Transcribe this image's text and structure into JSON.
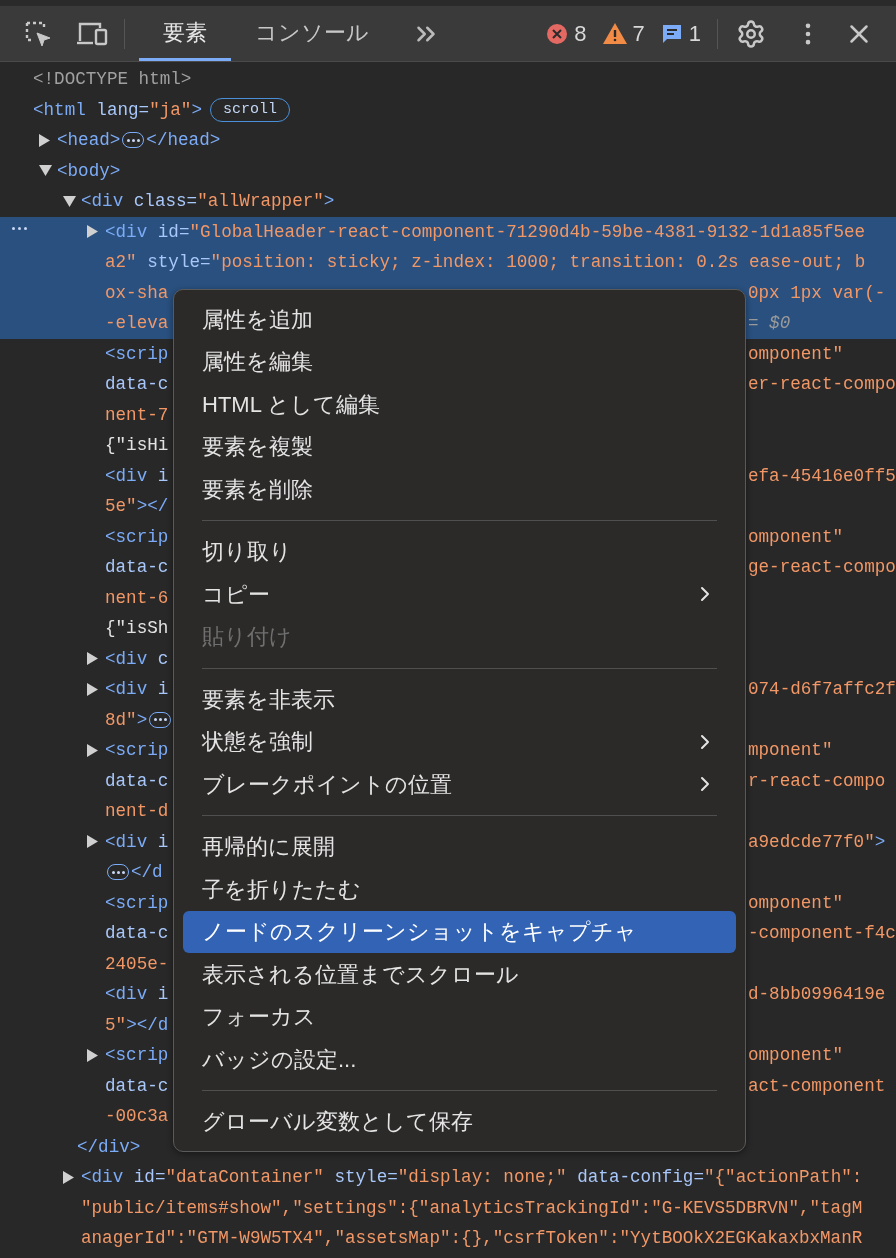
{
  "toolbar": {
    "tabs": [
      {
        "label": "要素",
        "selected": true
      },
      {
        "label": "コンソール",
        "selected": false
      }
    ],
    "counts": [
      {
        "kind": "error",
        "text": "8"
      },
      {
        "kind": "warning",
        "text": "7"
      },
      {
        "kind": "info",
        "text": "1"
      }
    ]
  },
  "tree": [
    {
      "kind": "leaf",
      "selected": false,
      "lines": [
        {
          "left": [
            {
              "kind": "doctype",
              "text": "<!DOCTYPE html>"
            }
          ]
        }
      ]
    },
    {
      "kind": "leaf",
      "selected": false,
      "lines": [
        {
          "left": [
            {
              "kind": "tag",
              "text": "<html"
            },
            {
              "kind": "attr",
              "text": " lang="
            },
            {
              "kind": "value",
              "text": "\"ja\""
            },
            {
              "kind": "tag",
              "text": ">"
            },
            {
              "kind": "badge",
              "text": "scroll"
            }
          ]
        }
      ],
      "children": [
        {
          "kind": "collapsed",
          "selected": false,
          "lines": [
            {
              "left": [
                {
                  "kind": "tag",
                  "text": "<head>"
                },
                {
                  "kind": "ellipsis"
                },
                {
                  "kind": "tag",
                  "text": "</head>"
                }
              ]
            }
          ]
        },
        {
          "kind": "expanded",
          "selected": false,
          "lines": [
            {
              "left": [
                {
                  "kind": "tag",
                  "text": "<body>"
                }
              ]
            }
          ],
          "children": [
            {
              "kind": "expanded",
              "selected": false,
              "lines": [
                {
                  "left": [
                    {
                      "kind": "tag",
                      "text": "<div"
                    },
                    {
                      "kind": "attr",
                      "text": " class="
                    },
                    {
                      "kind": "value",
                      "text": "\"allWrapper\""
                    },
                    {
                      "kind": "tag",
                      "text": ">"
                    }
                  ]
                }
              ],
              "closing": [
                {
                  "kind": "tag",
                  "text": "</div>"
                }
              ],
              "children": [
                {
                  "kind": "collapsed",
                  "selected": true,
                  "lines": [
                    {
                      "left": [
                        {
                          "kind": "tag",
                          "text": "<div"
                        },
                        {
                          "kind": "attr",
                          "text": " id="
                        },
                        {
                          "kind": "value",
                          "text": "\"GlobalHeader-react-component-71290d4b-59be-4381-9132-1d1a85f5ee"
                        }
                      ]
                    },
                    {
                      "left": [
                        {
                          "kind": "value",
                          "text": "a2\""
                        },
                        {
                          "kind": "attr",
                          "text": " style="
                        },
                        {
                          "kind": "value",
                          "text": "\"position: sticky; z-index: 1000; transition: 0.2s ease-out; b"
                        }
                      ]
                    },
                    {
                      "left": [
                        {
                          "kind": "value",
                          "text": "ox-sha"
                        }
                      ],
                      "right": [
                        {
                          "kind": "value",
                          "text": "0px 1px var(-"
                        }
                      ]
                    },
                    {
                      "left": [
                        {
                          "kind": "value",
                          "text": "-eleva"
                        }
                      ],
                      "right": [
                        {
                          "kind": "selref",
                          "text": "= $0"
                        }
                      ]
                    }
                  ]
                },
                {
                  "kind": "leaf",
                  "selected": false,
                  "lines": [
                    {
                      "left": [
                        {
                          "kind": "tag",
                          "text": "<scrip"
                        }
                      ],
                      "right": [
                        {
                          "kind": "value",
                          "text": "omponent\""
                        }
                      ]
                    },
                    {
                      "left": [
                        {
                          "kind": "attr",
                          "text": "data-c"
                        }
                      ],
                      "right": [
                        {
                          "kind": "value",
                          "text": "er-react-compo"
                        }
                      ]
                    },
                    {
                      "left": [
                        {
                          "kind": "value",
                          "text": "nent-7"
                        }
                      ]
                    },
                    {
                      "left": [
                        {
                          "kind": "text",
                          "text": "{\"isHi"
                        }
                      ]
                    }
                  ]
                },
                {
                  "kind": "leaf",
                  "selected": false,
                  "lines": [
                    {
                      "left": [
                        {
                          "kind": "tag",
                          "text": "<div"
                        },
                        {
                          "kind": "attr",
                          "text": " i"
                        }
                      ],
                      "right": [
                        {
                          "kind": "value",
                          "text": "efa-45416e0ff5"
                        }
                      ]
                    },
                    {
                      "left": [
                        {
                          "kind": "value",
                          "text": "5e\""
                        },
                        {
                          "kind": "tag",
                          "text": "></"
                        }
                      ]
                    }
                  ]
                },
                {
                  "kind": "leaf",
                  "selected": false,
                  "lines": [
                    {
                      "left": [
                        {
                          "kind": "tag",
                          "text": "<scrip"
                        }
                      ],
                      "right": [
                        {
                          "kind": "value",
                          "text": "omponent\""
                        }
                      ]
                    },
                    {
                      "left": [
                        {
                          "kind": "attr",
                          "text": "data-c"
                        }
                      ],
                      "right": [
                        {
                          "kind": "value",
                          "text": "ge-react-compo"
                        }
                      ]
                    },
                    {
                      "left": [
                        {
                          "kind": "value",
                          "text": "nent-6"
                        }
                      ]
                    },
                    {
                      "left": [
                        {
                          "kind": "text",
                          "text": "{\"isSh"
                        }
                      ]
                    }
                  ]
                },
                {
                  "kind": "collapsed",
                  "selected": false,
                  "lines": [
                    {
                      "left": [
                        {
                          "kind": "tag",
                          "text": "<div"
                        },
                        {
                          "kind": "attr",
                          "text": " c"
                        }
                      ]
                    }
                  ]
                },
                {
                  "kind": "collapsed",
                  "selected": false,
                  "lines": [
                    {
                      "left": [
                        {
                          "kind": "tag",
                          "text": "<div"
                        },
                        {
                          "kind": "attr",
                          "text": " i"
                        }
                      ],
                      "right": [
                        {
                          "kind": "value",
                          "text": "074-d6f7affc2f"
                        }
                      ]
                    },
                    {
                      "left": [
                        {
                          "kind": "value",
                          "text": "8d\""
                        },
                        {
                          "kind": "tag",
                          "text": ">"
                        },
                        {
                          "kind": "ellipsis"
                        }
                      ]
                    }
                  ]
                },
                {
                  "kind": "collapsed",
                  "selected": false,
                  "lines": [
                    {
                      "left": [
                        {
                          "kind": "tag",
                          "text": "<scrip"
                        }
                      ],
                      "right": [
                        {
                          "kind": "value",
                          "text": "mponent\""
                        }
                      ]
                    },
                    {
                      "left": [
                        {
                          "kind": "attr",
                          "text": "data-c"
                        }
                      ],
                      "right": [
                        {
                          "kind": "value",
                          "text": "r-react-compo"
                        }
                      ]
                    },
                    {
                      "left": [
                        {
                          "kind": "value",
                          "text": "nent-d"
                        }
                      ]
                    }
                  ]
                },
                {
                  "kind": "collapsed",
                  "selected": false,
                  "lines": [
                    {
                      "left": [
                        {
                          "kind": "tag",
                          "text": "<div"
                        },
                        {
                          "kind": "attr",
                          "text": " i"
                        }
                      ],
                      "right": [
                        {
                          "kind": "value",
                          "text": "a9edcde77f0\""
                        },
                        {
                          "kind": "tag",
                          "text": ">"
                        }
                      ]
                    },
                    {
                      "left": [
                        {
                          "kind": "ellipsis"
                        },
                        {
                          "kind": "tag",
                          "text": "</d"
                        }
                      ]
                    }
                  ]
                },
                {
                  "kind": "leaf",
                  "selected": false,
                  "lines": [
                    {
                      "left": [
                        {
                          "kind": "tag",
                          "text": "<scrip"
                        }
                      ],
                      "right": [
                        {
                          "kind": "value",
                          "text": "omponent\""
                        }
                      ]
                    },
                    {
                      "left": [
                        {
                          "kind": "attr",
                          "text": "data-c"
                        }
                      ],
                      "right": [
                        {
                          "kind": "value",
                          "text": "-component-f4c"
                        }
                      ]
                    },
                    {
                      "left": [
                        {
                          "kind": "value",
                          "text": "2405e-"
                        }
                      ]
                    }
                  ]
                },
                {
                  "kind": "leaf",
                  "selected": false,
                  "lines": [
                    {
                      "left": [
                        {
                          "kind": "tag",
                          "text": "<div"
                        },
                        {
                          "kind": "attr",
                          "text": " i"
                        }
                      ],
                      "right": [
                        {
                          "kind": "value",
                          "text": "d-8bb0996419e"
                        }
                      ]
                    },
                    {
                      "left": [
                        {
                          "kind": "value",
                          "text": "5\""
                        },
                        {
                          "kind": "tag",
                          "text": "></d"
                        }
                      ]
                    }
                  ]
                },
                {
                  "kind": "collapsed",
                  "selected": false,
                  "lines": [
                    {
                      "left": [
                        {
                          "kind": "tag",
                          "text": "<scrip"
                        }
                      ],
                      "right": [
                        {
                          "kind": "value",
                          "text": "omponent\""
                        }
                      ]
                    },
                    {
                      "left": [
                        {
                          "kind": "attr",
                          "text": "data-c"
                        }
                      ],
                      "right": [
                        {
                          "kind": "value",
                          "text": "act-component"
                        }
                      ]
                    },
                    {
                      "left": [
                        {
                          "kind": "value",
                          "text": "-00c3a"
                        }
                      ]
                    }
                  ]
                }
              ]
            },
            {
              "kind": "collapsed",
              "selected": false,
              "lines": [
                {
                  "left": [
                    {
                      "kind": "tag",
                      "text": "<div"
                    },
                    {
                      "kind": "attr",
                      "text": " id="
                    },
                    {
                      "kind": "value",
                      "text": "\"dataContainer\""
                    },
                    {
                      "kind": "attr",
                      "text": " style="
                    },
                    {
                      "kind": "value",
                      "text": "\"display: none;\""
                    },
                    {
                      "kind": "attr",
                      "text": " data-config="
                    },
                    {
                      "kind": "value",
                      "text": "\"{\"actionPath\":"
                    }
                  ]
                },
                {
                  "left": [
                    {
                      "kind": "value",
                      "text": "\"public/items#show\",\"settings\":{\"analyticsTrackingId\":\"G-KEVS5DBRVN\",\"tagM"
                    }
                  ]
                },
                {
                  "left": [
                    {
                      "kind": "value",
                      "text": "anagerId\":\"GTM-W9W5TX4\",\"assetsMap\":{},\"csrfToken\":\"YytBOOkX2EGKakaxbxManR"
                    }
                  ]
                }
              ]
            }
          ]
        }
      ]
    }
  ],
  "context_menu": {
    "items": [
      {
        "kind": "item",
        "label": "属性を追加",
        "selected": false,
        "disabled": false,
        "submenu": false
      },
      {
        "kind": "item",
        "label": "属性を編集",
        "selected": false,
        "disabled": false,
        "submenu": false
      },
      {
        "kind": "item",
        "label": "HTML として編集",
        "selected": false,
        "disabled": false,
        "submenu": false
      },
      {
        "kind": "item",
        "label": "要素を複製",
        "selected": false,
        "disabled": false,
        "submenu": false
      },
      {
        "kind": "item",
        "label": "要素を削除",
        "selected": false,
        "disabled": false,
        "submenu": false
      },
      {
        "kind": "separator"
      },
      {
        "kind": "item",
        "label": "切り取り",
        "selected": false,
        "disabled": false,
        "submenu": false
      },
      {
        "kind": "item",
        "label": "コピー",
        "selected": false,
        "disabled": false,
        "submenu": true
      },
      {
        "kind": "item",
        "label": "貼り付け",
        "selected": false,
        "disabled": true,
        "submenu": false
      },
      {
        "kind": "separator"
      },
      {
        "kind": "item",
        "label": "要素を非表示",
        "selected": false,
        "disabled": false,
        "submenu": false
      },
      {
        "kind": "item",
        "label": "状態を強制",
        "selected": false,
        "disabled": false,
        "submenu": true
      },
      {
        "kind": "item",
        "label": "ブレークポイントの位置",
        "selected": false,
        "disabled": false,
        "submenu": true
      },
      {
        "kind": "separator"
      },
      {
        "kind": "item",
        "label": "再帰的に展開",
        "selected": false,
        "disabled": false,
        "submenu": false
      },
      {
        "kind": "item",
        "label": "子を折りたたむ",
        "selected": false,
        "disabled": false,
        "submenu": false
      },
      {
        "kind": "item",
        "label": "ノードのスクリーンショットをキャプチャ",
        "selected": true,
        "disabled": false,
        "submenu": false
      },
      {
        "kind": "item",
        "label": "表示される位置までスクロール",
        "selected": false,
        "disabled": false,
        "submenu": false
      },
      {
        "kind": "item",
        "label": "フォーカス",
        "selected": false,
        "disabled": false,
        "submenu": false
      },
      {
        "kind": "item",
        "label": "バッジの設定...",
        "selected": false,
        "disabled": false,
        "submenu": false
      },
      {
        "kind": "separator"
      },
      {
        "kind": "item",
        "label": "グローバル変数として保存",
        "selected": false,
        "disabled": false,
        "submenu": false
      }
    ]
  }
}
